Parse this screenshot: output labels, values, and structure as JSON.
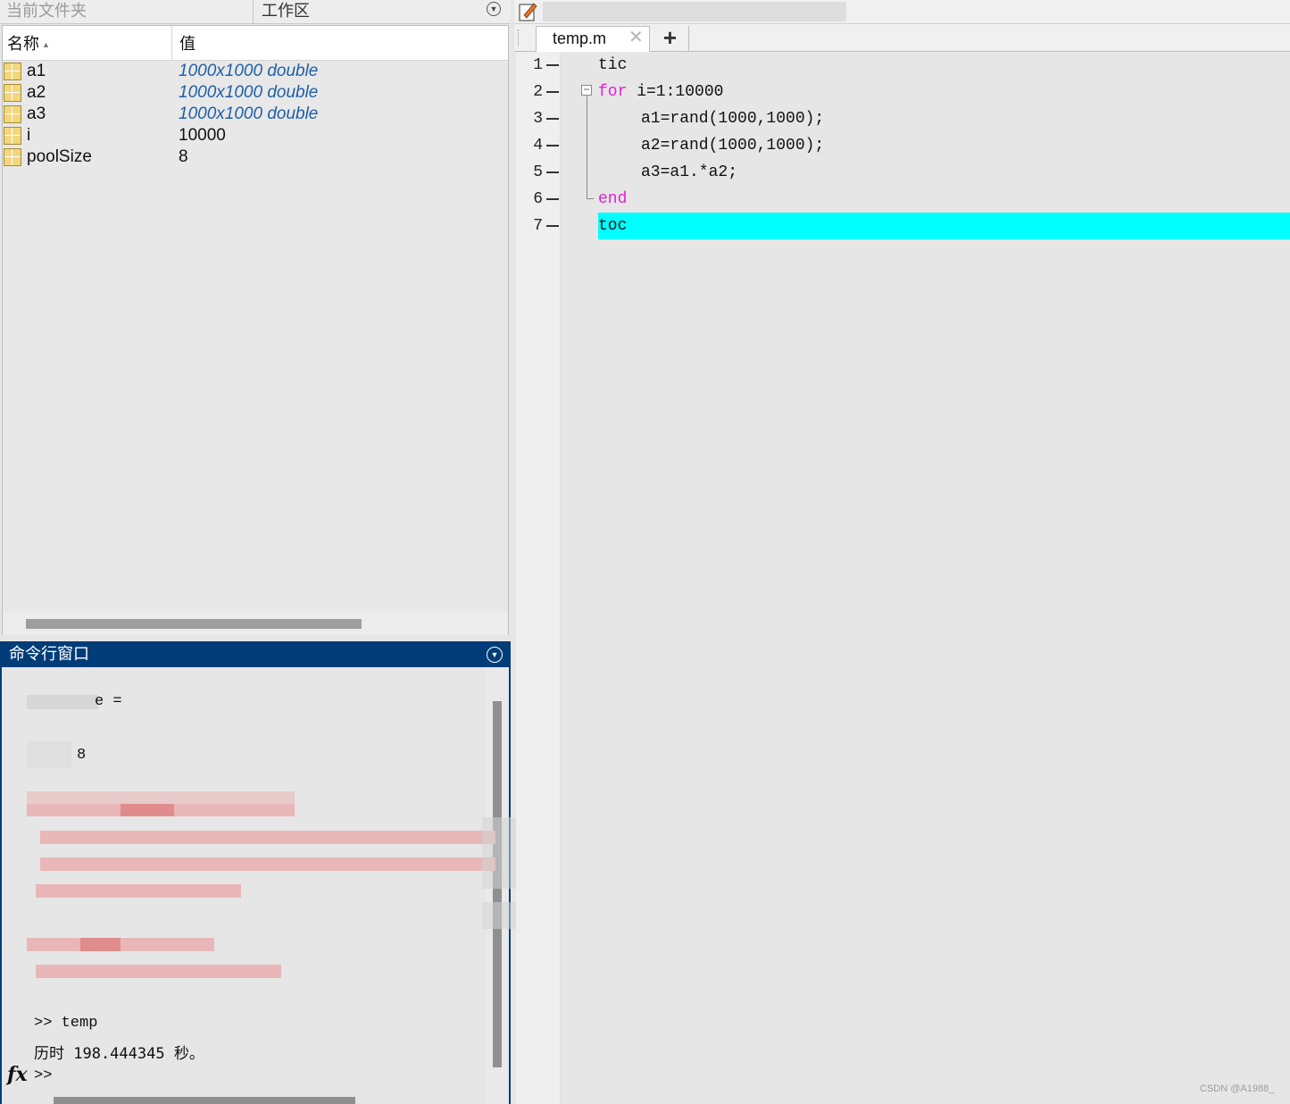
{
  "left_tabs": {
    "current_folder": "当前文件夹",
    "workspace": "工作区"
  },
  "workspace": {
    "col_name": "名称",
    "col_value": "值",
    "rows": [
      {
        "name": "a1",
        "value": "1000x1000 double"
      },
      {
        "name": "a2",
        "value": "1000x1000 double"
      },
      {
        "name": "a3",
        "value": "1000x1000 double"
      },
      {
        "name": "i",
        "value": "10000"
      },
      {
        "name": "poolSize",
        "value": "8"
      }
    ]
  },
  "command_window": {
    "title": "命令行窗口",
    "lines": {
      "equals": "e =",
      "value": "8",
      "prompt_cmd": ">> temp",
      "elapsed": "历时 198.444345 秒。",
      "prompt": ">>"
    },
    "fx": "fx"
  },
  "editor": {
    "tab": "temp.m",
    "close": "✕",
    "add": "+",
    "lines": [
      {
        "n": "1",
        "parts": [
          {
            "t": "tic",
            "k": false
          }
        ],
        "indent": 0
      },
      {
        "n": "2",
        "parts": [
          {
            "t": "for",
            "k": true
          },
          {
            "t": " i=1:10000",
            "k": false
          }
        ],
        "indent": 0
      },
      {
        "n": "3",
        "parts": [
          {
            "t": "a1=rand(1000,1000);",
            "k": false
          }
        ],
        "indent": 1
      },
      {
        "n": "4",
        "parts": [
          {
            "t": "a2=rand(1000,1000);",
            "k": false
          }
        ],
        "indent": 1
      },
      {
        "n": "5",
        "parts": [
          {
            "t": "a3=a1.*a2;",
            "k": false
          }
        ],
        "indent": 1
      },
      {
        "n": "6",
        "parts": [
          {
            "t": "end",
            "k": true
          }
        ],
        "indent": 0
      },
      {
        "n": "7",
        "parts": [
          {
            "t": "toc",
            "k": false
          }
        ],
        "indent": 0
      }
    ],
    "highlight_color": "#00ffff",
    "keyword_color": "#e020d8"
  },
  "watermark": "CSDN @A1988_"
}
